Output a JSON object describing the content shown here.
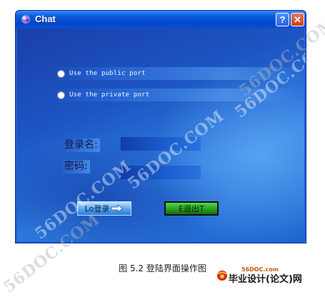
{
  "window": {
    "title": "Chat",
    "help_label": "?",
    "close_label": "✕"
  },
  "options": [
    {
      "label": "Use the public port"
    },
    {
      "label": "Use the private port"
    }
  ],
  "form": {
    "username_label": "登录名:",
    "password_label": "密码:",
    "username_value": "",
    "password_value": ""
  },
  "buttons": {
    "login_label": "Lo登录",
    "exit_label": "E退出T"
  },
  "caption": "图 5.2  登陆界面操作图",
  "brand": {
    "url": "56DOC.com",
    "name": "毕业设计(论文)网"
  },
  "watermark": "56DOC.COM",
  "colors": {
    "titlebar": "#0446c8",
    "client": "#1c56c4",
    "exit_button": "#2aa11e",
    "login_button": "#5aa6f0"
  },
  "icons": {
    "title": "chat-app-icon",
    "login_arrow": "arrow-right-icon",
    "brand": "globe-logo-icon"
  }
}
